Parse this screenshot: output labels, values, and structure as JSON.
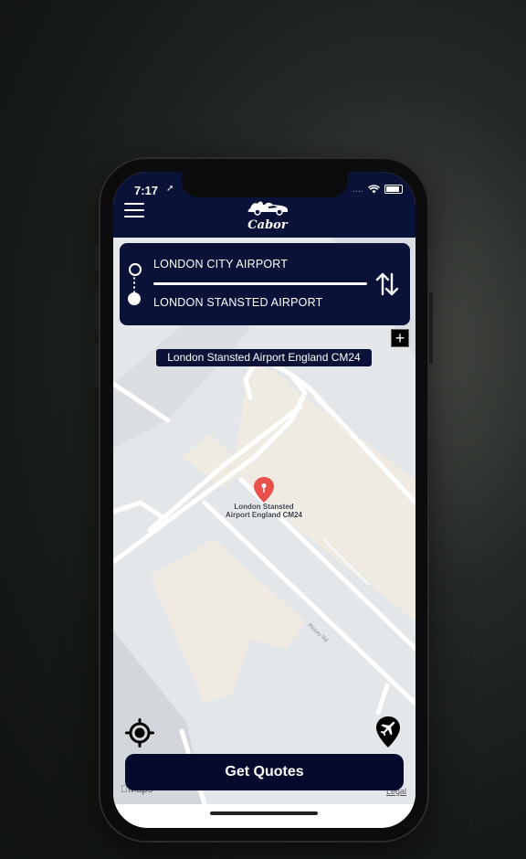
{
  "status_bar": {
    "time": "7:17",
    "signal": "....",
    "wifi_icon": "wifi-icon",
    "battery_icon": "battery-icon"
  },
  "header": {
    "menu_icon": "hamburger-menu-icon",
    "logo_text": "Cabor",
    "background": "#0a1238"
  },
  "route": {
    "from": "LONDON CITY AIRPORT",
    "to": "LONDON STANSTED AIRPORT",
    "swap_icon": "swap-arrows-icon"
  },
  "add_stop": {
    "label": "+"
  },
  "address_chip": "London Stansted Airport England CM24",
  "map": {
    "pin_label_line1": "London Stansted",
    "pin_label_line2": "Airport England CM24",
    "road_label": "Pincey Rd",
    "attribution": "Maps",
    "legal": "Legal"
  },
  "actions": {
    "locate_icon": "current-location-icon",
    "airport_icon": "airport-pin-icon",
    "get_quotes": "Get Quotes"
  },
  "colors": {
    "primary": "#0a1238",
    "button": "#050a2c",
    "pin": "#e8514b",
    "map_bg": "#e4e7ea"
  }
}
